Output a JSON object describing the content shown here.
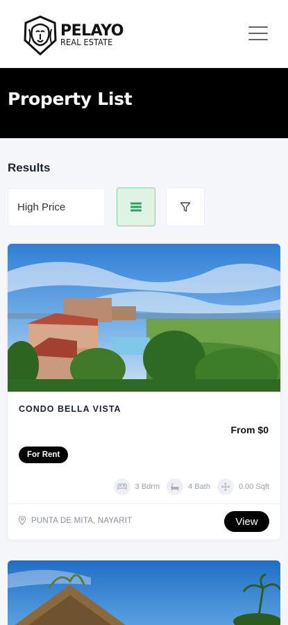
{
  "header": {
    "brand": "PELAYO",
    "brand_sub": "REAL ESTATE",
    "logo_icon": "lion-head-icon",
    "menu_icon": "hamburger-menu-icon"
  },
  "page": {
    "title": "Property List"
  },
  "results": {
    "label": "Results",
    "sort_value": "High Price",
    "list_view_icon": "list-view-icon",
    "filter_icon": "filter-icon",
    "accent_color": "#7ed29a"
  },
  "listings": [
    {
      "name": "CONDO BELLA VISTA",
      "price": "From $0",
      "badge": "For Rent",
      "bedrooms": "3 Bdrm",
      "baths": "4 Bath",
      "area": "0.00 Sqft",
      "location": "PUNTA DE MITA, NAYARIT",
      "view_label": "View"
    }
  ]
}
